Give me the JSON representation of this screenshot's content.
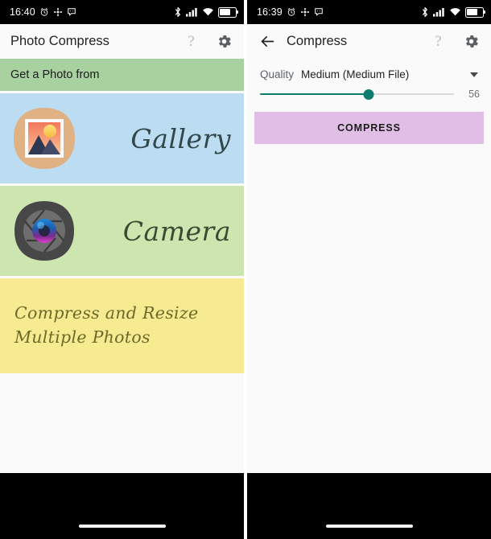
{
  "colors": {
    "banner_green": "#a8d1a0",
    "gallery_blue": "#bcdcf2",
    "camera_green": "#cde6af",
    "multi_yellow": "#f7eb92",
    "slider_teal": "#0f7d6d",
    "compress_button": "#e0bee6",
    "statusbar": "#000000",
    "app_background": "#fafafa"
  },
  "left_screen": {
    "status_bar": {
      "time": "16:40",
      "left_icons": [
        "alarm-icon",
        "bluetooth-share-icon",
        "chat-bubble-icon"
      ],
      "right_icons": [
        "bluetooth-icon",
        "cellular-signal-icon",
        "wifi-icon",
        "battery-icon"
      ],
      "battery_level": "90"
    },
    "app_bar": {
      "title": "Photo Compress",
      "help_glyph": "?",
      "actions": [
        "help-icon",
        "settings-gear-icon"
      ]
    },
    "banner": {
      "text": "Get a Photo from"
    },
    "sources": [
      {
        "label": "Gallery",
        "icon": "gallery-photo-icon"
      },
      {
        "label": "Camera",
        "icon": "camera-aperture-icon"
      }
    ],
    "multi_panel": {
      "text": "Compress and Resize Multiple Photos"
    },
    "nav_bar": {
      "indicator": "home-indicator-pill"
    }
  },
  "right_screen": {
    "status_bar": {
      "time": "16:39",
      "left_icons": [
        "alarm-icon",
        "bluetooth-share-icon",
        "chat-bubble-icon"
      ],
      "right_icons": [
        "bluetooth-icon",
        "cellular-signal-icon",
        "wifi-icon",
        "battery-icon"
      ],
      "battery_level": "90"
    },
    "app_bar": {
      "title": "Compress",
      "help_glyph": "?",
      "back": "back-arrow-icon",
      "actions": [
        "help-icon",
        "settings-gear-icon"
      ]
    },
    "quality": {
      "label": "Quality",
      "value": "Medium (Medium File)",
      "dropdown_icon": "chevron-down-icon"
    },
    "slider": {
      "value": "56",
      "percent": 56,
      "min": 0,
      "max": 100
    },
    "compress_button": {
      "label": "COMPRESS"
    },
    "nav_bar": {
      "indicator": "home-indicator-pill"
    }
  }
}
